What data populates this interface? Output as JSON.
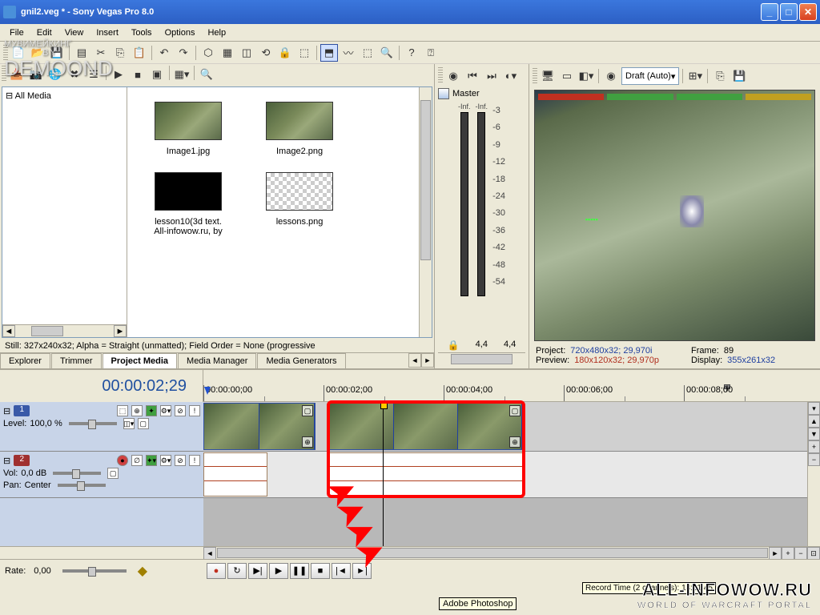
{
  "window": {
    "title": "gnil2.veg * - Sony Vegas Pro 8.0"
  },
  "menu": {
    "file": "File",
    "edit": "Edit",
    "view": "View",
    "insert": "Insert",
    "tools": "Tools",
    "options": "Options",
    "help": "Help"
  },
  "media_tree": {
    "root": "All Media"
  },
  "media_items": [
    {
      "name": "Image1.jpg"
    },
    {
      "name": "Image2.png"
    },
    {
      "name": "lesson10(3d text."
    },
    {
      "name": "lessons.png"
    }
  ],
  "media_subline": "All-infowow.ru, by",
  "media_info": "Still: 327x240x32; Alpha = Straight (unmatted); Field Order = None (progressive",
  "tabs": {
    "explorer": "Explorer",
    "trimmer": "Trimmer",
    "project_media": "Project Media",
    "media_manager": "Media Manager",
    "media_generators": "Media Generators"
  },
  "mixer": {
    "master": "Master",
    "top_l": "-Inf.",
    "top_r": "-Inf.",
    "bottom_l": "4,4",
    "bottom_r": "4,4",
    "scale": [
      "-3",
      "-6",
      "-9",
      "-12",
      "-18",
      "-24",
      "-30",
      "-36",
      "-42",
      "-48",
      "-54"
    ]
  },
  "preview": {
    "quality": "Draft (Auto)",
    "project_label": "Project:",
    "project_val": "720x480x32; 29,970i",
    "preview_label": "Preview:",
    "preview_val": "180x120x32; 29,970p",
    "frame_label": "Frame:",
    "frame_val": "89",
    "display_label": "Display:",
    "display_val": "355x261x32"
  },
  "timeline": {
    "cursor_time": "00:00:02;29",
    "ruler": [
      "00:00:00;00",
      "00:00:02;00",
      "00:00:04;00",
      "00:00:06;00",
      "00:00:08;00"
    ],
    "track1_num": "1",
    "track1_level_label": "Level:",
    "track1_level": "100,0 %",
    "track2_num": "2",
    "track2_vol_label": "Vol:",
    "track2_vol": "0,0 dB",
    "track2_pan_label": "Pan:",
    "track2_pan": "Center",
    "rate_label": "Rate:",
    "rate_val": "0,00"
  },
  "watermark": {
    "line1": "МУВИМЕЙКИНГ",
    "by": "BY",
    "name": "DEMOOND"
  },
  "record_time": "Record Time (2 channels): 18:21:45",
  "tooltip": "Adobe Photoshop",
  "brand": {
    "big": "ALL-INFOWOW.RU",
    "small": "WORLD OF WARCRAFT PORTAL"
  }
}
